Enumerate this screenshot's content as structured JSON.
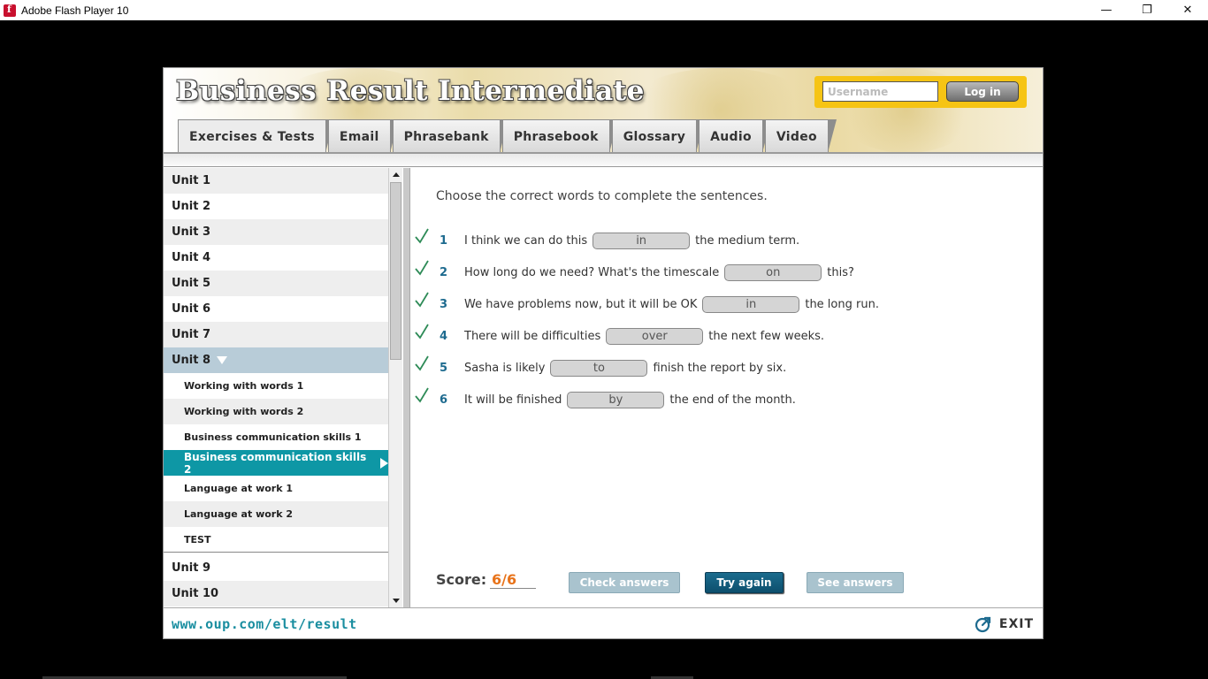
{
  "window": {
    "title": "Adobe Flash Player 10",
    "minimize_glyph": "—",
    "restore_glyph": "❐",
    "close_glyph": "✕"
  },
  "header": {
    "app_title": "Business Result Intermediate",
    "username_placeholder": "Username",
    "login_label": "Log in"
  },
  "tabs": [
    {
      "label": "Exercises & Tests",
      "active": true
    },
    {
      "label": "Email"
    },
    {
      "label": "Phrasebank"
    },
    {
      "label": "Phrasebook"
    },
    {
      "label": "Glossary"
    },
    {
      "label": "Audio"
    },
    {
      "label": "Video"
    }
  ],
  "sidebar": {
    "units_before": [
      "Unit 1",
      "Unit 2",
      "Unit 3",
      "Unit 4",
      "Unit 5",
      "Unit 6",
      "Unit 7"
    ],
    "open_unit": "Unit 8",
    "sub_items": [
      "Working with words 1",
      "Working with words 2",
      "Business communication skills 1",
      "Business communication skills 2",
      "Language at work 1",
      "Language at work 2",
      "TEST"
    ],
    "selected_sub_index": 3,
    "units_after": [
      "Unit 9",
      "Unit 10"
    ]
  },
  "exercise": {
    "instructions": "Choose the correct words to complete the sentences.",
    "questions": [
      {
        "num": "1",
        "before": "I think we can do this",
        "answer": "in",
        "after": "the medium term."
      },
      {
        "num": "2",
        "before": "How long do we need? What's the timescale",
        "answer": "on",
        "after": "this?"
      },
      {
        "num": "3",
        "before": "We have problems now, but it will be OK",
        "answer": "in",
        "after": "the long run."
      },
      {
        "num": "4",
        "before": "There will be difficulties",
        "answer": "over",
        "after": "the next few weeks."
      },
      {
        "num": "5",
        "before": "Sasha is likely",
        "answer": "to",
        "after": "finish the report by six."
      },
      {
        "num": "6",
        "before": "It will be finished",
        "answer": "by",
        "after": "the end of the month."
      }
    ],
    "score_label": "Score:",
    "score_value": "6/6",
    "buttons": {
      "check": "Check answers",
      "try_again": "Try again",
      "see": "See answers"
    }
  },
  "footer": {
    "url": "www.oup.com/elt/result",
    "exit_label": "EXIT"
  },
  "colors": {
    "accent_teal": "#0e97a5",
    "primary_button": "#0d4f6d",
    "score_orange": "#e8731a",
    "login_yellow": "#f6c414",
    "check_green": "#2e8b57"
  }
}
